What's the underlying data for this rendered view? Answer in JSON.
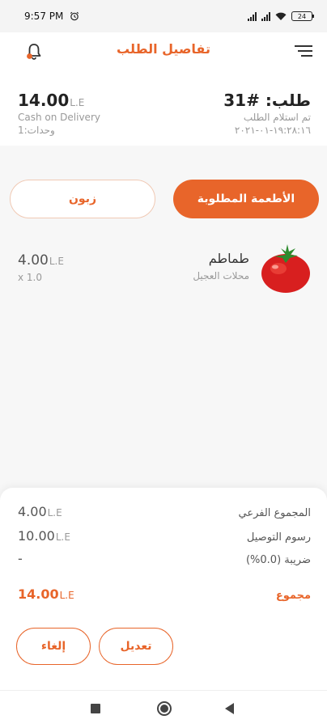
{
  "status_bar": {
    "time": "9:57 PM",
    "battery": "24"
  },
  "app_bar": {
    "title": "تفاصيل الطلب"
  },
  "order": {
    "id": "طلب: #31",
    "received_label": "تم استلام الطلب",
    "date": "١٩:٢٨:١٦-٠١-٢٠٢١",
    "total_amount": "14.00",
    "currency": "L.E",
    "payment_method": "Cash on Delivery",
    "units": "وحدات:1"
  },
  "tabs": {
    "items_label": "الأطعمة المطلوبة",
    "customer_label": "زبون"
  },
  "items": [
    {
      "name": "طماطم",
      "store": "محلات العجيل",
      "price": "4.00",
      "currency": "L.E",
      "quantity": "x 1.0",
      "icon": "tomato-icon"
    }
  ],
  "summary": {
    "subtotal_label": "المجموع الفرعي",
    "subtotal": "4.00",
    "delivery_label": "رسوم التوصيل",
    "delivery": "10.00",
    "tax_label": "ضريبة (0.0%)",
    "tax": "-",
    "total_label": "مجموع",
    "total": "14.00",
    "currency": "L.E"
  },
  "actions": {
    "edit_label": "تعديل",
    "cancel_label": "إلغاء"
  },
  "colors": {
    "accent": "#e8652a",
    "background": "#f7f7f7"
  }
}
